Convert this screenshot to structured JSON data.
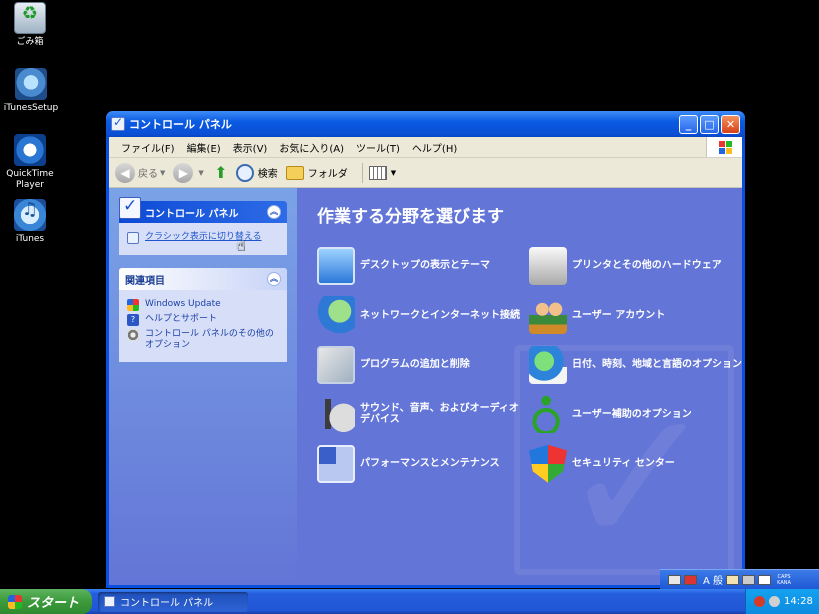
{
  "desktop": {
    "icons": [
      {
        "label": "ごみ箱"
      },
      {
        "label": "iTunesSetup"
      },
      {
        "label": "QuickTime Player"
      },
      {
        "label": "iTunes"
      }
    ]
  },
  "window": {
    "title": "コントロール パネル",
    "menu": [
      "ファイル(F)",
      "編集(E)",
      "表示(V)",
      "お気に入り(A)",
      "ツール(T)",
      "ヘルプ(H)"
    ],
    "toolbar": {
      "back": "戻る",
      "search": "検索",
      "folders": "フォルダ"
    },
    "taskpane": {
      "cp_panel": {
        "title": "コントロール パネル",
        "switch_link": "クラシック表示に切り替える"
      },
      "related": {
        "title": "関連項目",
        "links": [
          "Windows Update",
          "ヘルプとサポート",
          "コントロール パネルのその他のオプション"
        ]
      }
    },
    "main": {
      "heading": "作業する分野を選びます",
      "categories": [
        "デスクトップの表示とテーマ",
        "プリンタとその他のハードウェア",
        "ネットワークとインターネット接続",
        "ユーザー アカウント",
        "プログラムの追加と削除",
        "日付、時刻、地域と言語のオプション",
        "サウンド、音声、およびオーディオ デバイス",
        "ユーザー補助のオプション",
        "パフォーマンスとメンテナンス",
        "セキュリティ センター"
      ]
    }
  },
  "langbar": {
    "ime_mode": "A 般",
    "caps": "CAPS",
    "kana": "KANA"
  },
  "taskbar": {
    "start_label": "スタート",
    "task_title": "コントロール パネル",
    "clock": "14:28"
  }
}
